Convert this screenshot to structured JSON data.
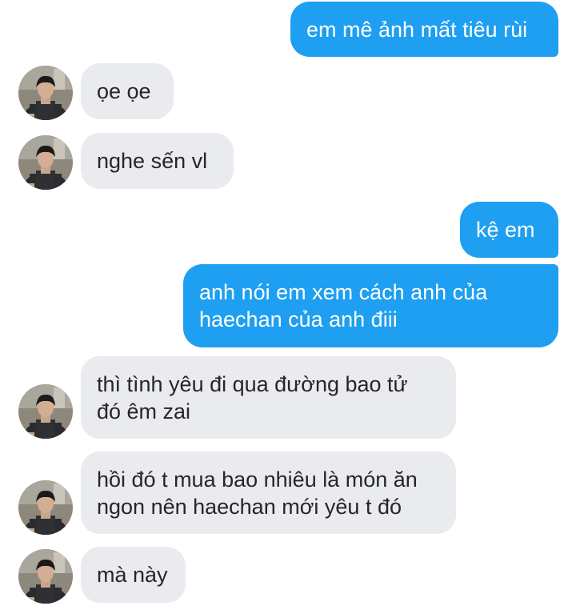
{
  "messages": [
    {
      "side": "out",
      "text": "em mê ảnh mất tiêu rùi"
    },
    {
      "side": "in",
      "text": "ọe ọe"
    },
    {
      "side": "in",
      "text": "nghe sến vl"
    },
    {
      "side": "out",
      "text": "kệ em"
    },
    {
      "side": "out",
      "text": "anh nói em xem cách anh của\nhaechan của anh điii"
    },
    {
      "side": "in",
      "text": "thì tình yêu đi qua đường bao tử\nđó êm zai"
    },
    {
      "side": "in",
      "text": "hồi đó t mua bao nhiêu là món ăn\nngon nên haechan mới yêu t đó"
    },
    {
      "side": "in",
      "text": "mà này"
    }
  ],
  "colors": {
    "outgoing_bubble": "#1e9ff1",
    "incoming_bubble": "#e9ebee",
    "outgoing_text": "#ffffff",
    "incoming_text": "#262626"
  }
}
